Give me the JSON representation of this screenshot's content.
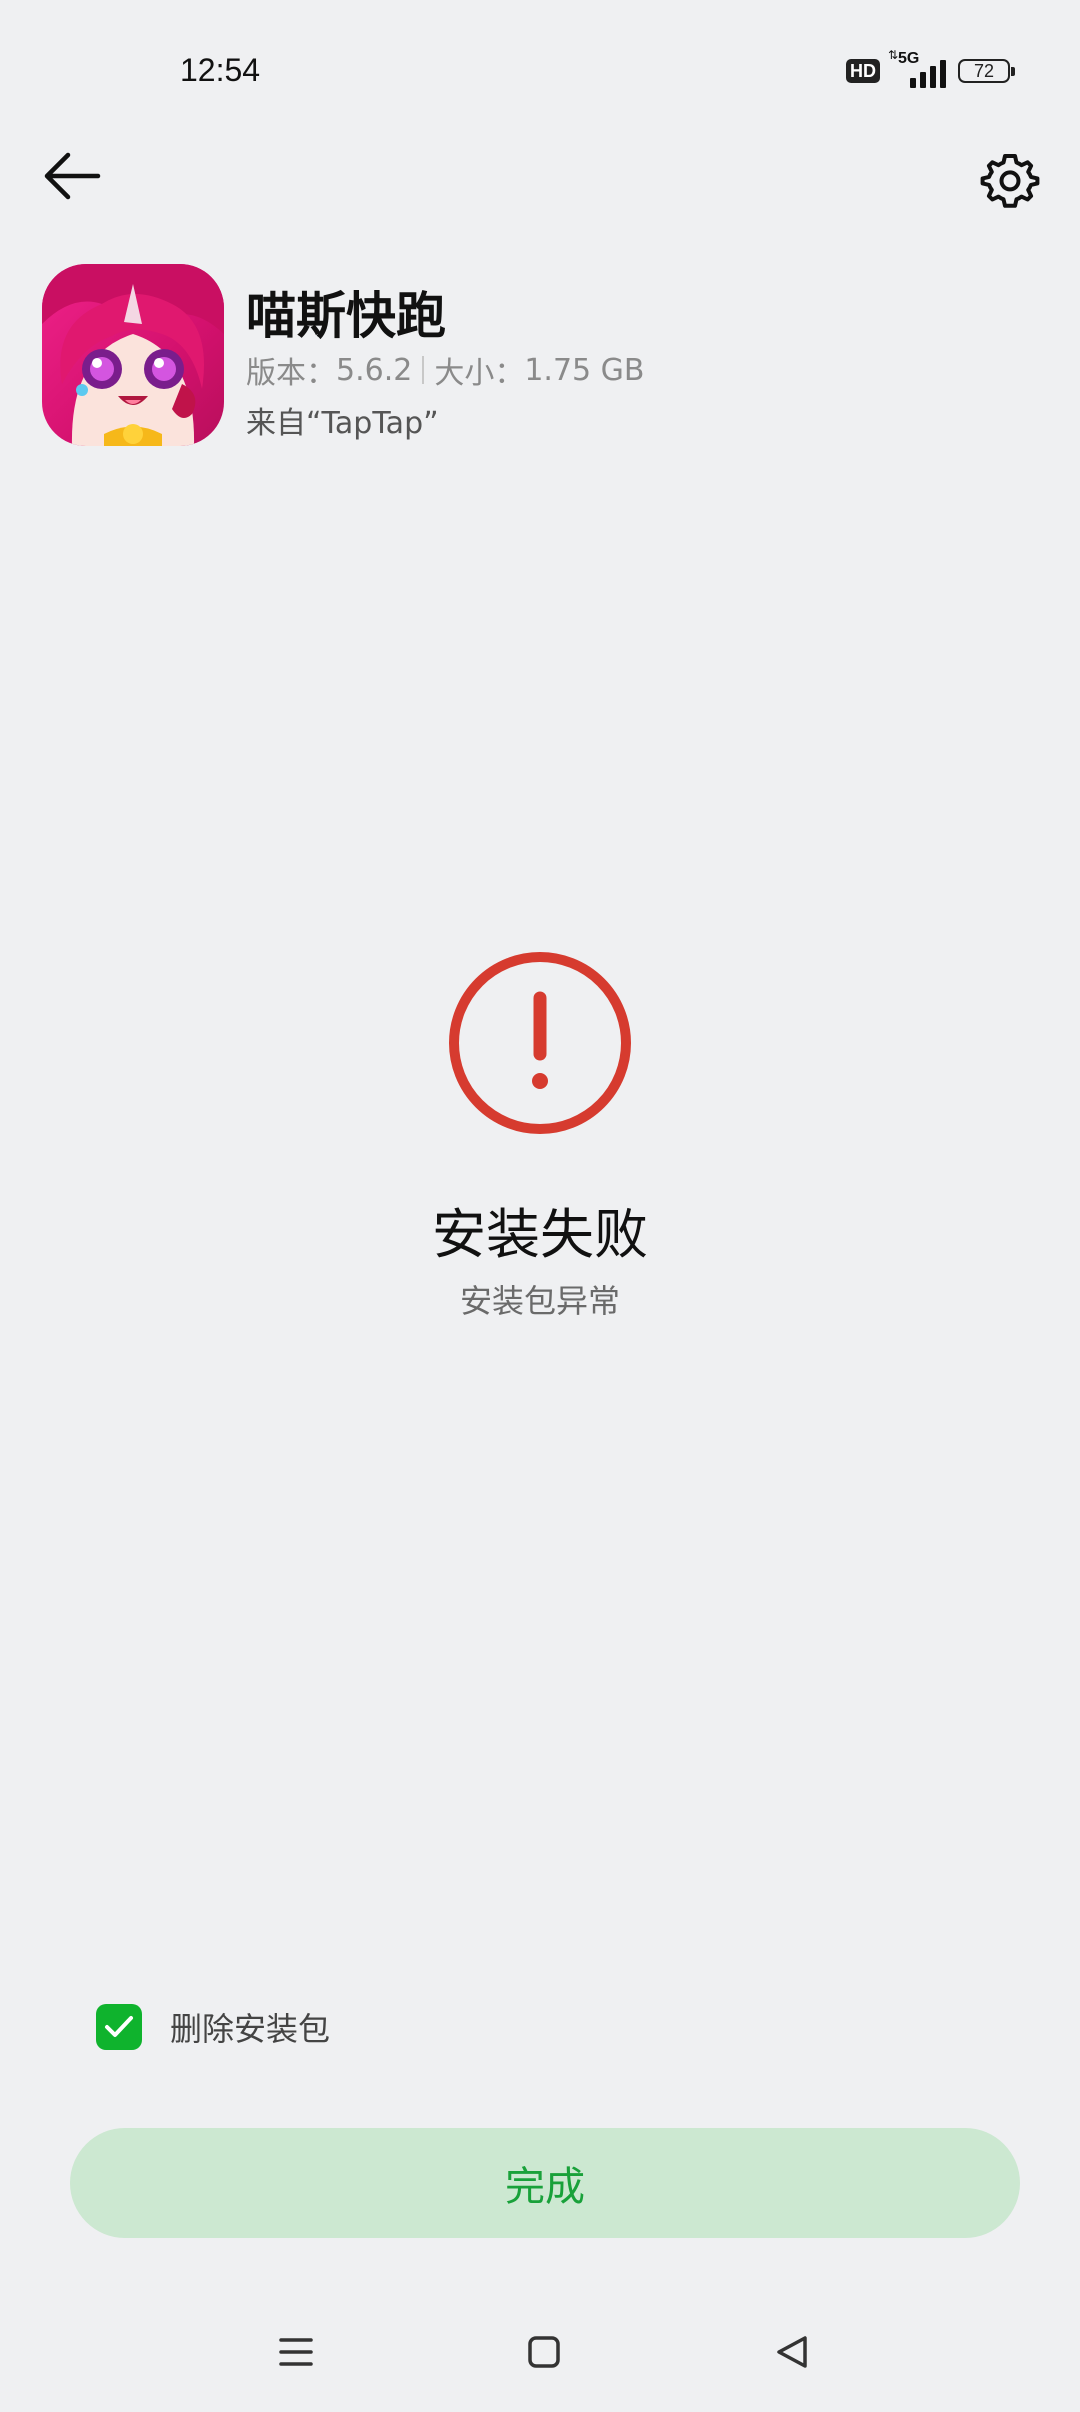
{
  "status_bar": {
    "time": "12:54",
    "hd_badge": "HD",
    "network": "5G",
    "battery": "72"
  },
  "app": {
    "name": "喵斯快跑",
    "version_label": "版本：",
    "version": "5.6.2",
    "size_label": "大小：",
    "size": "1.75 GB",
    "source": "来自“TapTap”"
  },
  "result": {
    "title": "安装失败",
    "subtitle": "安装包异常",
    "status_color": "#d63b2f"
  },
  "options": {
    "delete_package_label": "删除安装包",
    "delete_package_checked": true
  },
  "actions": {
    "done_label": "完成"
  },
  "icons": {
    "back": "back-arrow-icon",
    "settings": "gear-icon",
    "error": "exclamation-circle-icon",
    "checkbox": "check-icon",
    "nav_menu": "menu-icon",
    "nav_home": "home-square-icon",
    "nav_back": "back-triangle-icon"
  },
  "colors": {
    "background": "#eff0f2",
    "accent_green": "#19a13a",
    "button_bg": "#cce8d1",
    "checkbox_green": "#0fb32d",
    "error_red": "#d63b2f"
  }
}
